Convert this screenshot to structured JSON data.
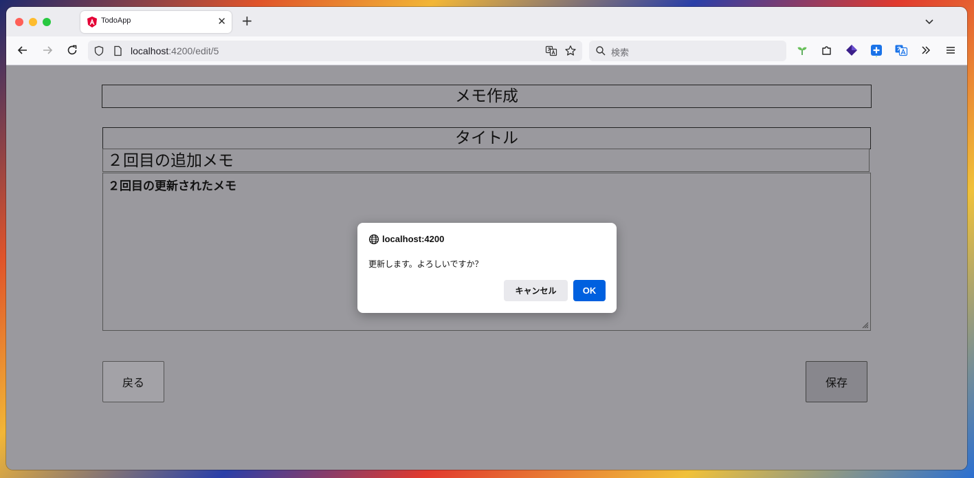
{
  "browser": {
    "tab": {
      "title": "TodoApp"
    },
    "url": {
      "host": "localhost",
      "path": ":4200/edit/5"
    },
    "search": {
      "placeholder": "検索"
    }
  },
  "page": {
    "heading": "メモ作成",
    "title_label": "タイトル",
    "title_value": "２回目の追加メモ",
    "body_value": "２回目の更新されたメモ",
    "back_label": "戻る",
    "save_label": "保存"
  },
  "dialog": {
    "origin": "localhost:4200",
    "message": "更新します。よろしいですか？",
    "cancel_label": "キャンセル",
    "ok_label": "OK"
  },
  "colors": {
    "accent": "#0060df",
    "overlay": "#9a999e"
  }
}
